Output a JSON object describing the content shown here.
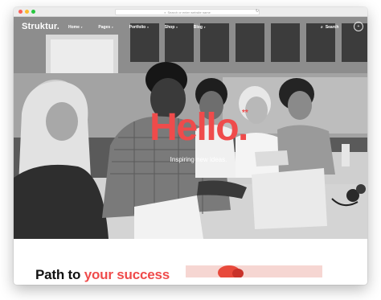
{
  "browser": {
    "address_placeholder": "Search or enter website name",
    "search_glyph": "⌕",
    "reload_glyph": "↻"
  },
  "nav": {
    "logo": "Struktur.",
    "items": [
      {
        "label": "Home",
        "has_dropdown": true
      },
      {
        "label": "Pages",
        "has_dropdown": true
      },
      {
        "label": "Portfolio",
        "has_dropdown": true
      },
      {
        "label": "Shop",
        "has_dropdown": true
      },
      {
        "label": "Blog",
        "has_dropdown": true
      }
    ],
    "caret_glyph": "▾",
    "search_label": "Search",
    "search_glyph": "⌕",
    "menu_toggle_glyph": "+"
  },
  "hero": {
    "title": "Hello.",
    "mark": "**",
    "subtitle": "Inspiring new ideas."
  },
  "section": {
    "title_plain": "Path to ",
    "title_accent": "your success"
  },
  "colors": {
    "accent": "#ef4b4b",
    "hero_overlay": "#4a4a4a",
    "nav_text": "#ffffff"
  }
}
